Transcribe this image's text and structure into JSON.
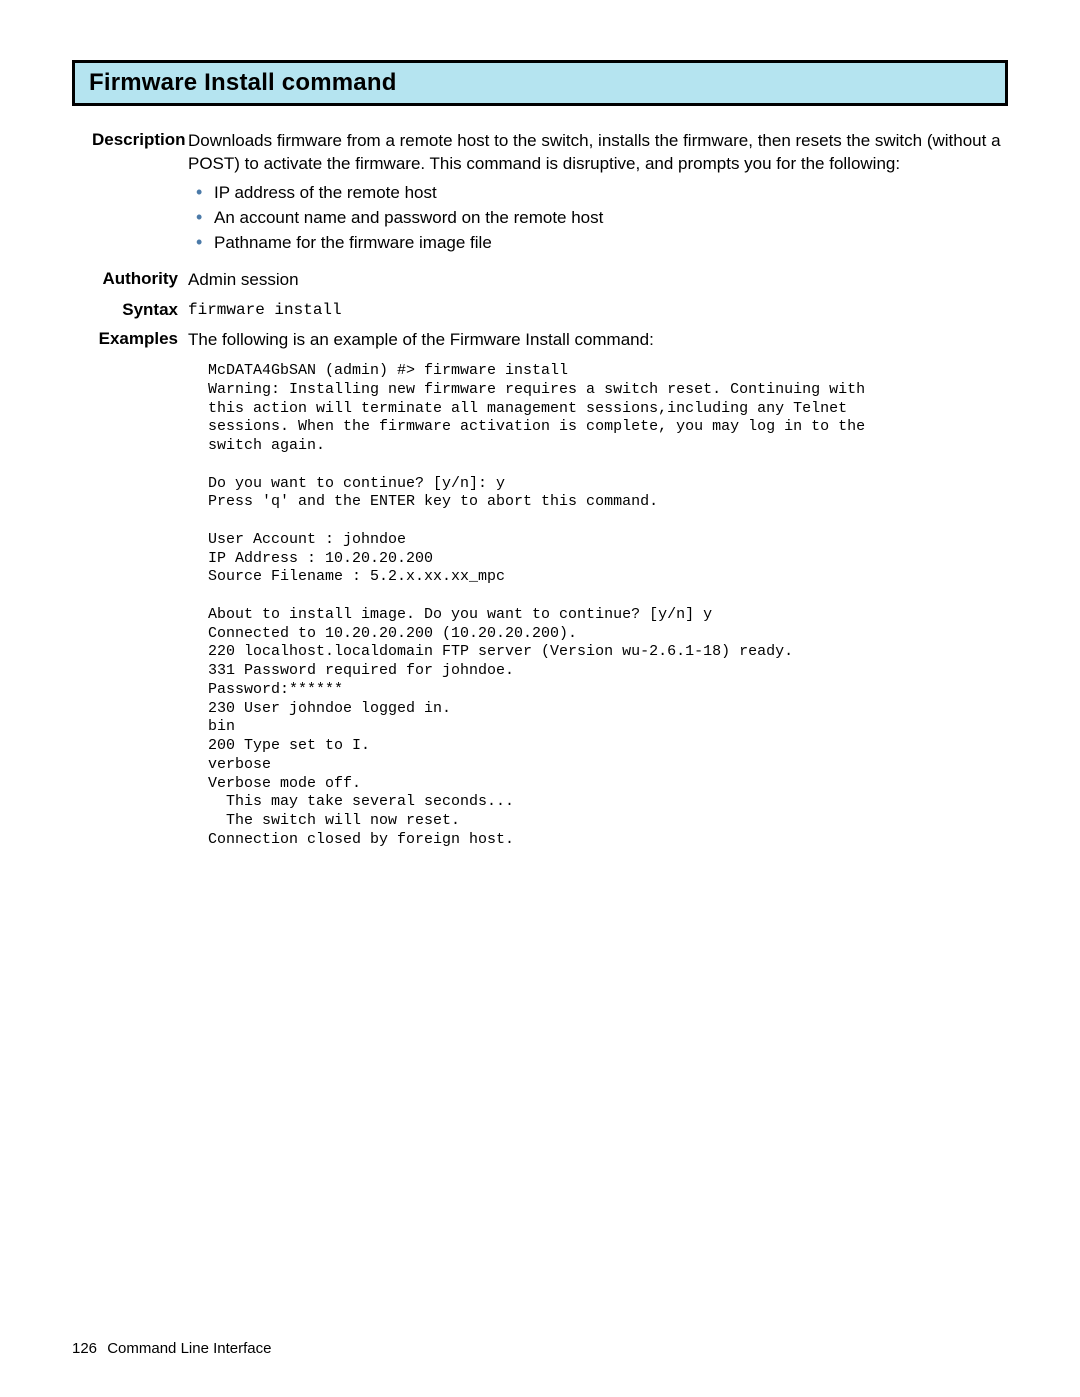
{
  "title": "Firmware Install command",
  "sections": {
    "description": {
      "label": "Description",
      "text": "Downloads firmware from a remote host to the switch, installs the firmware, then resets the switch (without a POST) to activate the firmware. This command is disruptive, and prompts you for the following:",
      "bullets": [
        "IP address of the remote host",
        "An account name and password on the remote host",
        "Pathname for the firmware image file"
      ]
    },
    "authority": {
      "label": "Authority",
      "text": "Admin session"
    },
    "syntax": {
      "label": "Syntax",
      "text": "firmware install"
    },
    "examples": {
      "label": "Examples",
      "intro": "The following is an example of the Firmware Install command:",
      "code": "McDATA4GbSAN (admin) #> firmware install\nWarning: Installing new firmware requires a switch reset. Continuing with\nthis action will terminate all management sessions,including any Telnet\nsessions. When the firmware activation is complete, you may log in to the\nswitch again.\n\nDo you want to continue? [y/n]: y\nPress 'q' and the ENTER key to abort this command.\n\nUser Account : johndoe\nIP Address : 10.20.20.200\nSource Filename : 5.2.x.xx.xx_mpc\n\nAbout to install image. Do you want to continue? [y/n] y\nConnected to 10.20.20.200 (10.20.20.200).\n220 localhost.localdomain FTP server (Version wu-2.6.1-18) ready.\n331 Password required for johndoe.\nPassword:******\n230 User johndoe logged in.\nbin\n200 Type set to I.\nverbose\nVerbose mode off.\n  This may take several seconds...\n  The switch will now reset.\nConnection closed by foreign host."
    }
  },
  "footer": {
    "page_number": "126",
    "section_name": "Command Line Interface"
  }
}
